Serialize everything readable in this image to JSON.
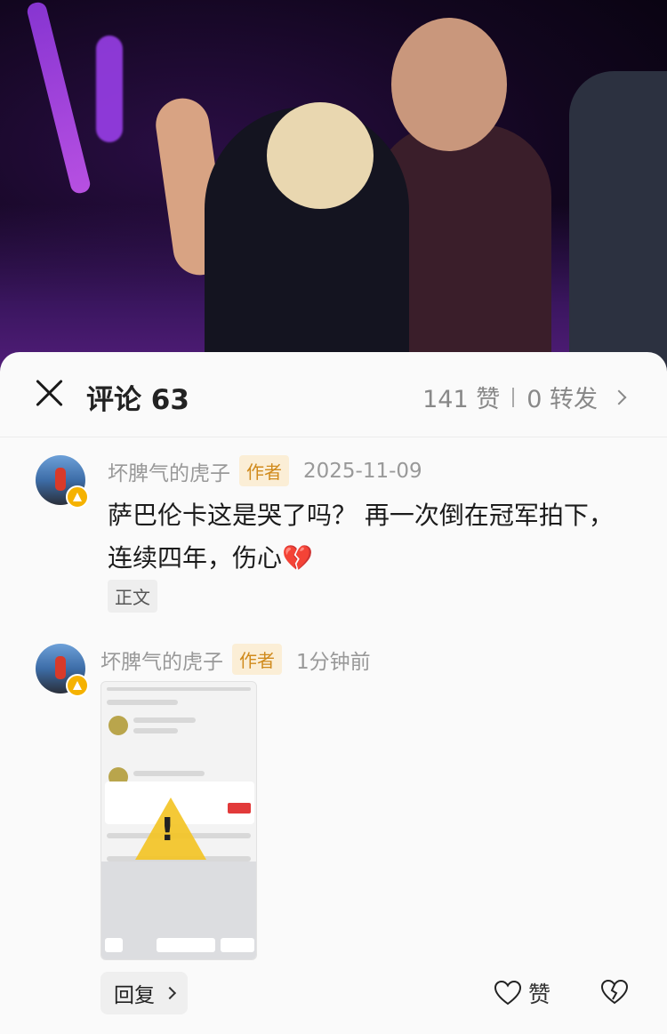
{
  "header": {
    "title": "评论 63",
    "likes": "141 赞",
    "shares": "0 转发"
  },
  "comments": [
    {
      "username": "坏脾气的虎子",
      "author_tag": "作者",
      "date": "2025-11-09",
      "text": "萨巴伦卡这是哭了吗？  再一次倒在冠军拍下，连续四年，伤心",
      "emoji": "💔",
      "tag": "正文"
    },
    {
      "username": "坏脾气的虎子",
      "author_tag": "作者",
      "date": "1分钟前"
    }
  ],
  "actions": {
    "reply": "回复",
    "like": "赞"
  },
  "icons": {
    "close": "close-icon",
    "like": "heart-icon",
    "dislike": "broken-heart-icon",
    "warning": "warning-icon"
  },
  "colors": {
    "author_tag_bg": "#fbeed6",
    "author_tag_text": "#d08a1c"
  }
}
